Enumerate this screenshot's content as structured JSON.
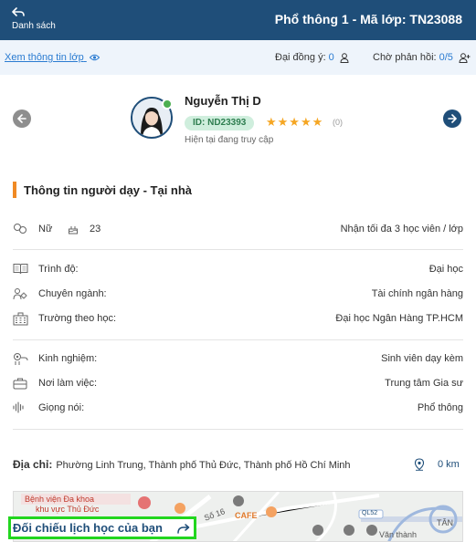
{
  "header": {
    "back_label": "Danh sách",
    "title": "Phổ thông 1 - Mã lớp: TN23088"
  },
  "info_bar": {
    "view_class_label": "Xem thông tin lớp",
    "agreed_label": "Đại đồng ý:",
    "agreed_count": "0",
    "waiting_label": "Chờ phản hồi:",
    "waiting_count": "0/5"
  },
  "tutor": {
    "name": "Nguyễn Thị D",
    "id_badge": "ID: ND23393",
    "stars": "★★★★★",
    "rating_count": "(0)",
    "rating_value": 5,
    "status": "Hiện tại đang truy cập",
    "online": true
  },
  "section": {
    "title": "Thông tin người dạy - Tại nhà"
  },
  "basics": {
    "gender": "Nữ",
    "age": "23",
    "capacity": "Nhận tối đa 3 học viên / lớp"
  },
  "education": [
    {
      "label": "Trình độ:",
      "value": "Đại học",
      "icon": "book-icon"
    },
    {
      "label": "Chuyên ngành:",
      "value": "Tài chính ngân hàng",
      "icon": "major-icon"
    },
    {
      "label": "Trường theo học:",
      "value": "Đại học Ngân Hàng TP.HCM",
      "icon": "school-icon"
    }
  ],
  "experience": [
    {
      "label": "Kinh nghiệm:",
      "value": "Sinh viên dạy kèm",
      "icon": "experience-icon"
    },
    {
      "label": "Nơi làm việc:",
      "value": "Trung tâm Gia sư",
      "icon": "briefcase-icon"
    },
    {
      "label": "Giọng nói:",
      "value": "Phổ thông",
      "icon": "voice-icon"
    }
  ],
  "address": {
    "label": "Địa chỉ:",
    "value": "Phường Linh Trung, Thành phố Thủ Đức, Thành phố Hồ Chí Minh",
    "distance": "0 km"
  },
  "map": {
    "hospital_line1": "Bệnh viện Đa khoa",
    "hospital_line2": "khu vực Thủ Đức",
    "cafe": "CAFE",
    "road_16": "Số 16",
    "ql52": "QL52",
    "tan": "TÂN",
    "van_thanh": "Văn thành"
  },
  "compare_button": "Đối chiếu lịch học của bạn",
  "colors": {
    "header_bg": "#1f4e79",
    "accent_orange": "#f08a24",
    "link_blue": "#2a7bd1",
    "highlight_green": "#22d61f",
    "badge_bg": "#cfeedd"
  }
}
